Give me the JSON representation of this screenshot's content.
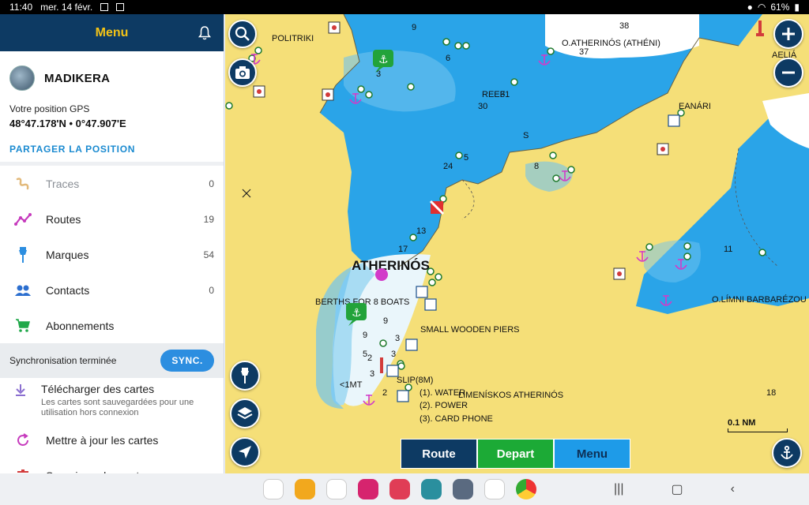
{
  "status": {
    "time": "11:40",
    "date": "mer. 14 févr.",
    "battery": "61%"
  },
  "menu": {
    "title": "Menu",
    "username": "MADIKERA",
    "gps_label": "Votre position GPS",
    "gps_value": "48°47.178'N • 0°47.907'E",
    "share": "PARTAGER LA POSITION",
    "items": [
      {
        "label": "Traces",
        "count": "0",
        "icon": "traces-icon"
      },
      {
        "label": "Routes",
        "count": "19",
        "icon": "routes-icon"
      },
      {
        "label": "Marques",
        "count": "54",
        "icon": "pin-icon"
      },
      {
        "label": "Contacts",
        "count": "0",
        "icon": "contacts-icon"
      },
      {
        "label": "Abonnements",
        "count": "",
        "icon": "cart-icon"
      }
    ],
    "sync_text": "Synchronisation terminée",
    "sync_button": "SYNC.",
    "download_title": "Télécharger des cartes",
    "download_sub": "Les cartes sont sauvegardées pour une utilisation hors connexion",
    "update_label": "Mettre à jour les cartes",
    "delete_label": "Supprimer des cartes"
  },
  "map": {
    "labels": {
      "politriki": "POLITRIKI",
      "atherinos_athen": "O.ATHERINÓS (ATHÉNI)",
      "aelia": "AELIÁ",
      "reef": "REEF",
      "eanari": "EANÁRI",
      "atherinos": "ATHERINÓS",
      "berths": "BERTHS FOR 8 BOATS",
      "piers": "SMALL WOODEN PIERS",
      "slip": "SLIP(8M)",
      "water": "(1). WATER",
      "power": "(2). POWER",
      "card": "(3). CARD PHONE",
      "limeniskos": "LIMENÍSKOS ATHERINÓS",
      "barbarezou": "O.LÍMNI BARBARÉZOU",
      "lt1m": "<1MT",
      "s": "S",
      "scale": "0.1 NM"
    },
    "depths": [
      "9",
      "38",
      "37",
      "3",
      "6",
      "31",
      "30",
      "24",
      "5",
      "8",
      "13",
      "17",
      "11",
      "9",
      "9",
      "5",
      "2",
      "3",
      "3",
      "3",
      "2",
      "18"
    ],
    "tabs": {
      "route": "Route",
      "depart": "Depart",
      "menu": "Menu"
    }
  }
}
